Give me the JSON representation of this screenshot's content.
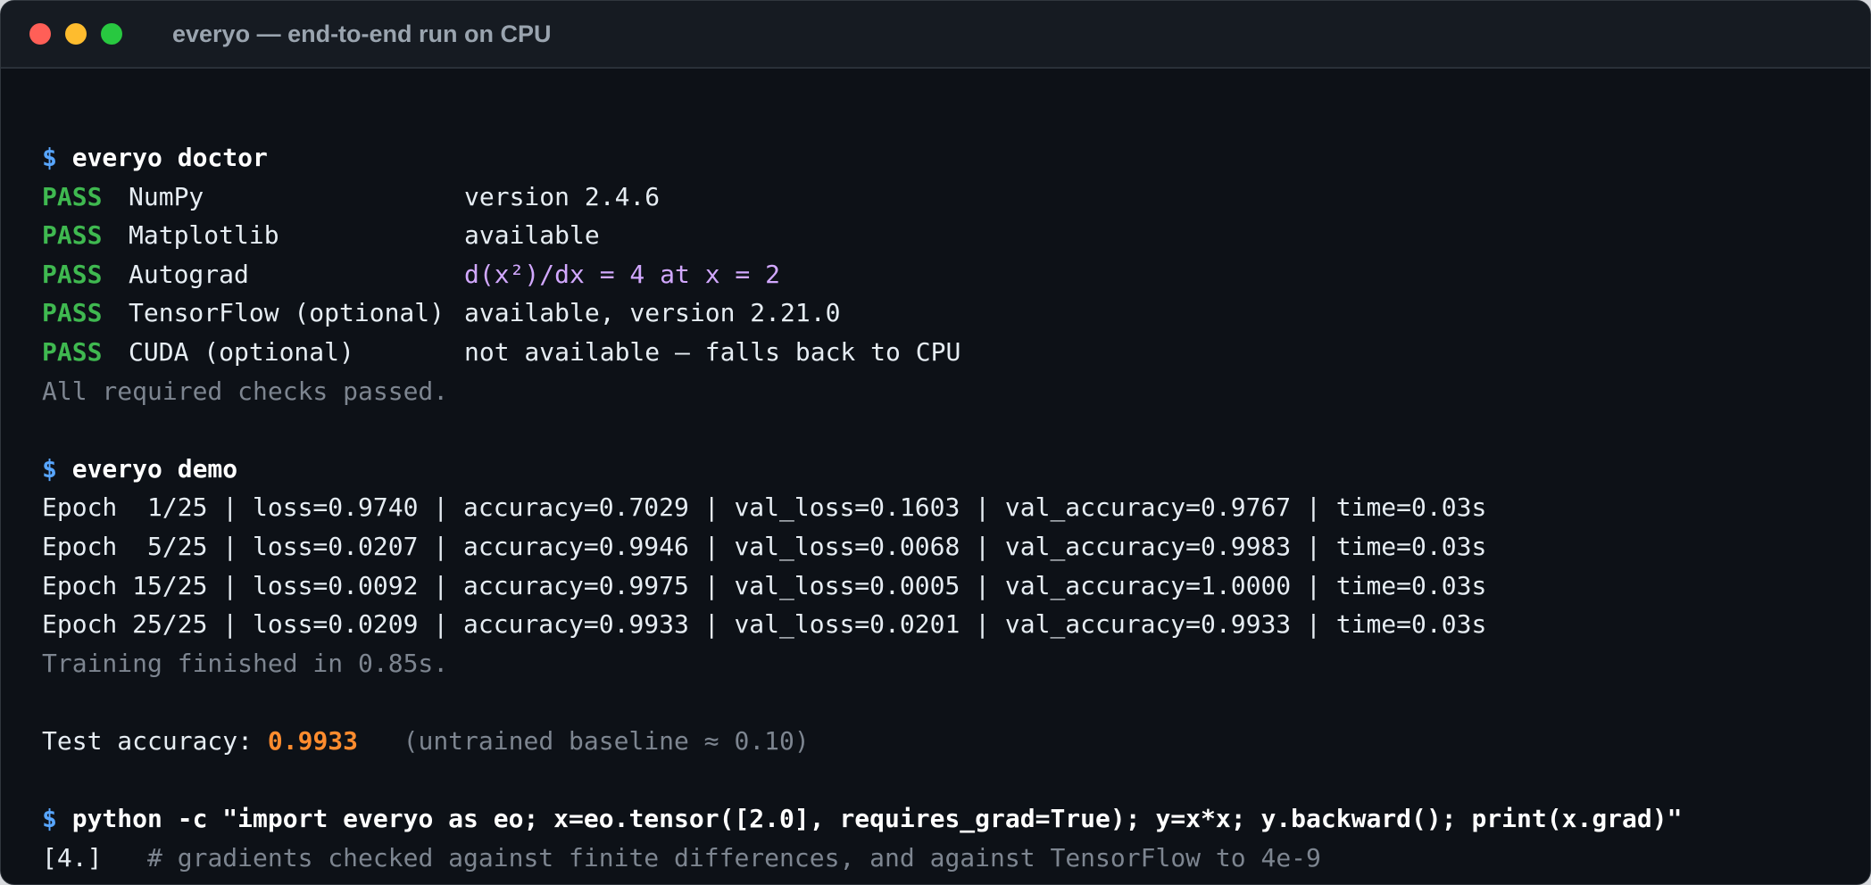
{
  "window": {
    "title": "everyo — end-to-end run on CPU"
  },
  "prompt_symbol": "$",
  "doctor": {
    "command": "everyo doctor",
    "checks": [
      {
        "status": "PASS",
        "name": "NumPy",
        "result": "version 2.4.6"
      },
      {
        "status": "PASS",
        "name": "Matplotlib",
        "result": "available"
      },
      {
        "status": "PASS",
        "name": "Autograd",
        "result": "d(x²)/dx = 4 at x = 2"
      },
      {
        "status": "PASS",
        "name": "TensorFlow (optional)",
        "result": "available, version 2.21.0"
      },
      {
        "status": "PASS",
        "name": "CUDA (optional)",
        "result": "not available — falls back to CPU"
      }
    ],
    "summary": "All required checks passed."
  },
  "demo": {
    "command": "everyo demo",
    "epochs": [
      "Epoch  1/25 | loss=0.9740 | accuracy=0.7029 | val_loss=0.1603 | val_accuracy=0.9767 | time=0.03s",
      "Epoch  5/25 | loss=0.0207 | accuracy=0.9946 | val_loss=0.0068 | val_accuracy=0.9983 | time=0.03s",
      "Epoch 15/25 | loss=0.0092 | accuracy=0.9975 | val_loss=0.0005 | val_accuracy=1.0000 | time=0.03s",
      "Epoch 25/25 | loss=0.0209 | accuracy=0.9933 | val_loss=0.0201 | val_accuracy=0.9933 | time=0.03s"
    ],
    "finished": "Training finished in 0.85s.",
    "test_label": "Test accuracy: ",
    "test_value": "0.9933",
    "baseline": "   (untrained baseline ≈ 0.10)"
  },
  "python": {
    "command": "python -c \"import everyo as eo; x=eo.tensor([2.0], requires_grad=True); y=x*x; y.backward(); print(x.grad)\"",
    "output": "[4.]",
    "comment": "   # gradients checked against finite differences, and against TensorFlow to 4e-9"
  }
}
